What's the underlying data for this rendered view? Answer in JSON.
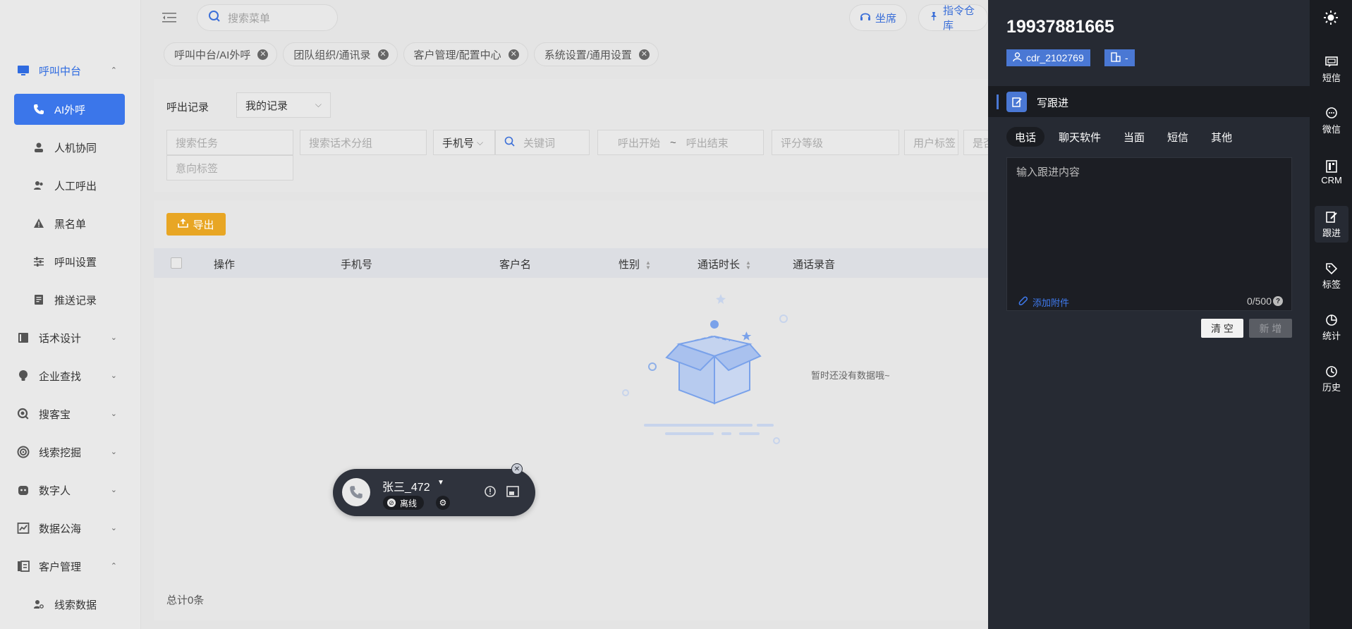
{
  "sidebar": {
    "items": [
      {
        "label": "呼叫中台",
        "icon": "monitor-icon",
        "chevron": "⌃"
      },
      {
        "label": "AI外呼",
        "icon": "phone-icon"
      },
      {
        "label": "人机协同",
        "icon": "user-robot-icon"
      },
      {
        "label": "人工呼出",
        "icon": "users-icon"
      },
      {
        "label": "黑名单",
        "icon": "warning-icon"
      },
      {
        "label": "呼叫设置",
        "icon": "sliders-icon"
      },
      {
        "label": "推送记录",
        "icon": "document-icon"
      },
      {
        "label": "话术设计",
        "icon": "book-icon",
        "chevron": "⌄"
      },
      {
        "label": "企业查找",
        "icon": "lightbulb-icon",
        "chevron": "⌄"
      },
      {
        "label": "搜客宝",
        "icon": "search-circle-icon",
        "chevron": "⌄"
      },
      {
        "label": "线索挖掘",
        "icon": "target-icon",
        "chevron": "⌄"
      },
      {
        "label": "数字人",
        "icon": "robot-icon",
        "chevron": "⌄"
      },
      {
        "label": "数据公海",
        "icon": "chart-icon",
        "chevron": "⌄"
      },
      {
        "label": "客户管理",
        "icon": "contacts-icon",
        "chevron": "⌃"
      },
      {
        "label": "线索数据",
        "icon": "user-search-icon"
      }
    ]
  },
  "topbar": {
    "search_placeholder": "搜索菜单",
    "seat_label": "坐席",
    "command_label": "指令仓库"
  },
  "tabs": [
    {
      "label": "呼叫中台/AI外呼"
    },
    {
      "label": "团队组织/通讯录"
    },
    {
      "label": "客户管理/配置中心"
    },
    {
      "label": "系统设置/通用设置"
    }
  ],
  "filters": {
    "record_label": "呼出记录",
    "record_select": "我的记录",
    "task_placeholder": "搜索任务",
    "script_group_placeholder": "搜索话术分组",
    "phone_select": "手机号",
    "keyword_placeholder": "关键词",
    "call_start": "呼出开始",
    "range_sep": "~",
    "call_end": "呼出结束",
    "score_placeholder": "评分等级",
    "user_tag_placeholder": "用户标签",
    "truncated_placeholder": "是否",
    "intent_tag_placeholder": "意向标签"
  },
  "table": {
    "export_label": "导出",
    "columns": [
      "操作",
      "手机号",
      "客户名",
      "性别",
      "通话时长",
      "通话录音"
    ],
    "empty_text": "暂时还没有数据哦~",
    "total_text": "总计0条"
  },
  "call_widget": {
    "name": "张三_472",
    "status": "离线"
  },
  "panel": {
    "phone_number": "19937881665",
    "customer_id": "cdr_2102769",
    "company_tag": "-",
    "section_title": "写跟进",
    "types": [
      "电话",
      "聊天软件",
      "当面",
      "短信",
      "其他"
    ],
    "content_placeholder": "输入跟进内容",
    "attach_label": "添加附件",
    "char_count": "0/500",
    "help_mark": "?",
    "clear_label": "清 空",
    "add_label": "新 增"
  },
  "rail": [
    {
      "label": "短信",
      "icon": "message-icon"
    },
    {
      "label": "微信",
      "icon": "chat-icon"
    },
    {
      "label": "CRM",
      "icon": "crm-icon"
    },
    {
      "label": "跟进",
      "icon": "edit-note-icon"
    },
    {
      "label": "标签",
      "icon": "tag-icon"
    },
    {
      "label": "统计",
      "icon": "pie-icon"
    },
    {
      "label": "历史",
      "icon": "clock-icon"
    }
  ],
  "colors": {
    "accent": "#3b76ea",
    "export": "#e8a624",
    "panel_bg": "#262a33",
    "rail_bg": "#1a1c21"
  }
}
